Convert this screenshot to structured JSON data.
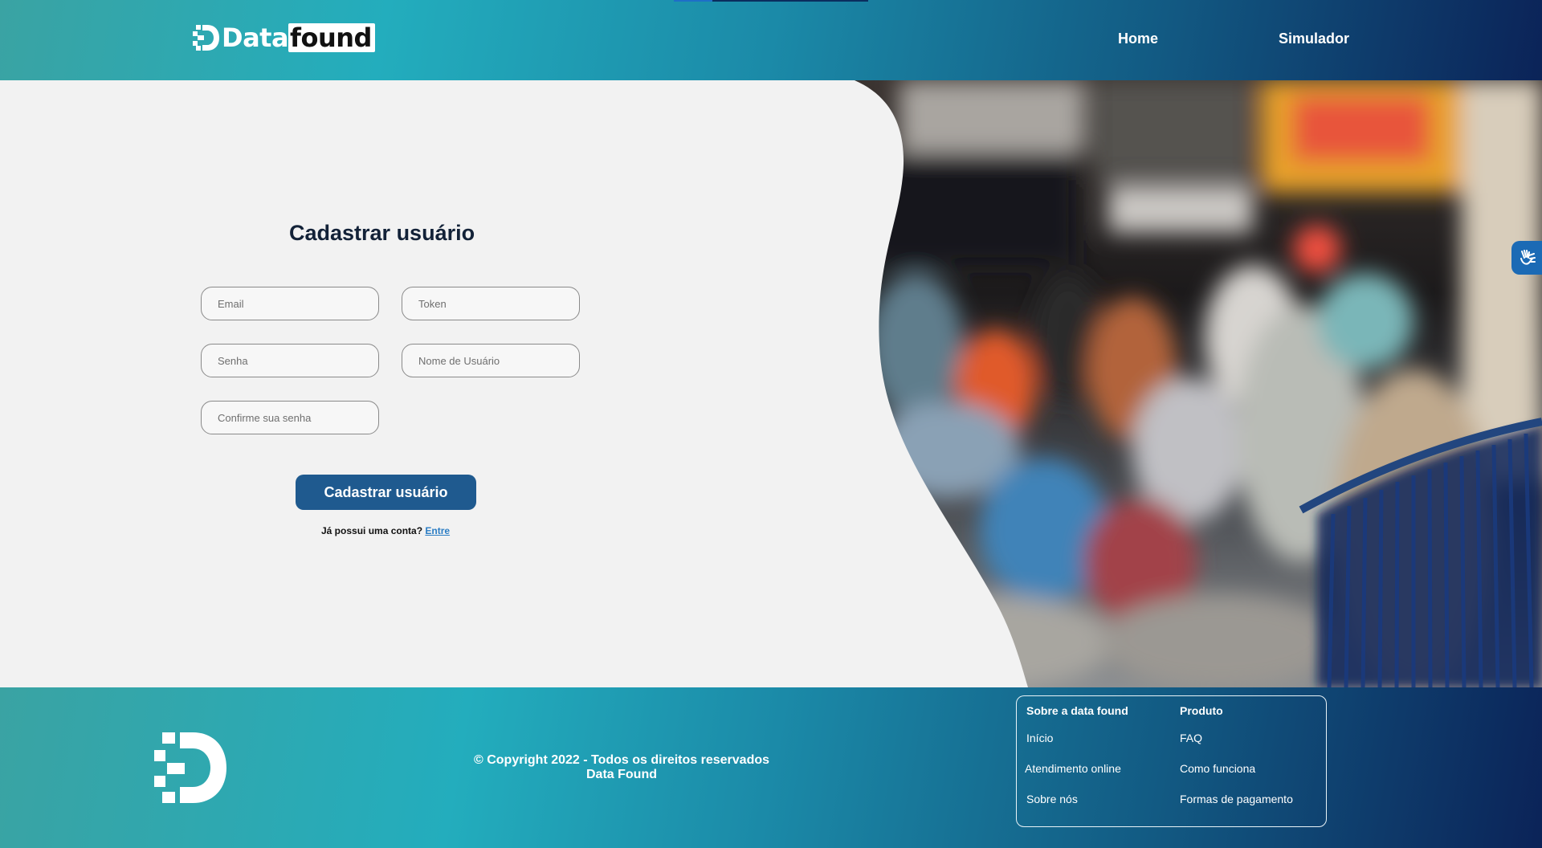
{
  "header": {
    "logo": {
      "data_text": "Data",
      "found_text": "found"
    },
    "nav": [
      {
        "label": "Home"
      },
      {
        "label": "Simulador"
      }
    ]
  },
  "form": {
    "title": "Cadastrar usuário",
    "fields": {
      "email": {
        "placeholder": "Email",
        "value": ""
      },
      "token": {
        "placeholder": "Token",
        "value": ""
      },
      "senha": {
        "placeholder": "Senha",
        "value": ""
      },
      "nome": {
        "placeholder": "Nome de Usuário",
        "value": ""
      },
      "confirm": {
        "placeholder": "Confirme sua senha",
        "value": ""
      }
    },
    "submit_label": "Cadastrar usuário",
    "login_prompt": "Já possui uma conta?",
    "login_link": "Entre"
  },
  "accessibility": {
    "icon": "sign-language-hands-icon"
  },
  "footer": {
    "copyright_line1": "© Copyright 2022 - Todos os direitos reservados",
    "copyright_line2": "Data Found",
    "about": {
      "heading": "Sobre a data found",
      "items": [
        "Início",
        "Atendimento online",
        "Sobre nós"
      ]
    },
    "product": {
      "heading": "Produto",
      "items": [
        "FAQ",
        "Como funciona",
        "Formas de pagamento"
      ]
    }
  },
  "colors": {
    "header_gradient_start": "#23adbd",
    "header_gradient_end": "#0b2358",
    "primary_button": "#1f5a8f",
    "link": "#2b7dc4",
    "title_text": "#132238"
  }
}
